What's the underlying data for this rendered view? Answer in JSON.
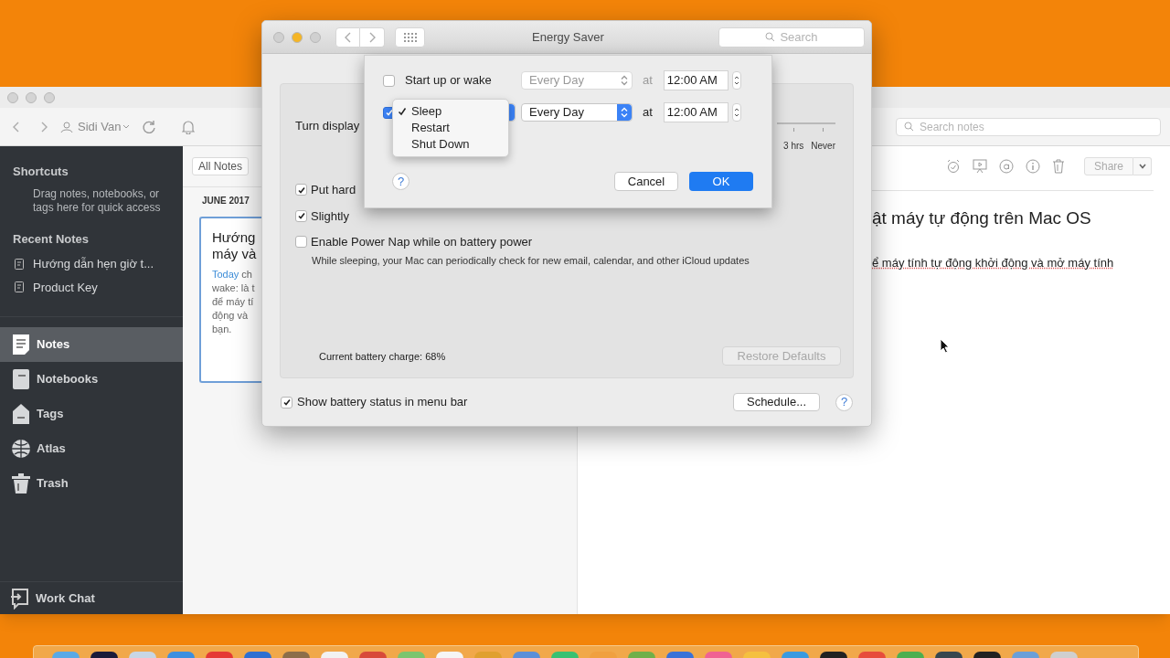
{
  "notes_app": {
    "toolbar": {
      "account": "Sidi Van",
      "search_placeholder": "Search notes"
    },
    "sidebar": {
      "shortcuts_heading": "Shortcuts",
      "shortcuts_hint": "Drag notes, notebooks, or tags here for quick access",
      "recent_heading": "Recent Notes",
      "recent": [
        "Hướng dẫn hẹn giờ t...",
        "Product Key"
      ],
      "items": [
        {
          "label": "Notes",
          "kind": "notes",
          "selected": true
        },
        {
          "label": "Notebooks",
          "kind": "notebooks",
          "selected": false
        },
        {
          "label": "Tags",
          "kind": "tags",
          "selected": false
        },
        {
          "label": "Atlas",
          "kind": "atlas",
          "selected": false
        },
        {
          "label": "Trash",
          "kind": "trash",
          "selected": false
        }
      ],
      "work_chat": "Work Chat"
    },
    "note_list": {
      "filter": "All Notes",
      "month": "JUNE 2017",
      "card": {
        "selected": true,
        "title_lines": [
          "Hướng",
          "máy và"
        ],
        "date": "Today",
        "snippet_lines": [
          "ch",
          "wake: là t",
          "để máy tí",
          "động và",
          "bạn."
        ]
      }
    },
    "editor": {
      "share": "Share",
      "title": "ật máy tự động trên Mac OS",
      "body": "ể máy tính tự động khởi động và mở máy tính"
    }
  },
  "energy_saver": {
    "title": "Energy Saver",
    "search_placeholder": "Search",
    "turn_display_label": "Turn display",
    "slider_ticks": [
      "3 hrs",
      "Never"
    ],
    "options": [
      {
        "label": "Put hard",
        "checked": true
      },
      {
        "label": "Slightly",
        "checked": true
      },
      {
        "label": "Enable Power Nap while on battery power",
        "checked": false,
        "description": "While sleeping, your Mac can periodically check for new email, calendar, and other iCloud updates"
      }
    ],
    "battery_charge": "Current battery charge: 68%",
    "restore_defaults": {
      "label": "Restore Defaults",
      "disabled": true
    },
    "show_battery": {
      "label": "Show battery status in menu bar",
      "checked": true
    },
    "schedule_button": "Schedule...",
    "help": "?",
    "schedule_sheet": {
      "rows": [
        {
          "checked": false,
          "label": "Start up or wake",
          "day": "Every Day",
          "disabled": true,
          "at": "at",
          "time": "12:00 AM"
        },
        {
          "checked": true,
          "day": "Every Day",
          "disabled": false,
          "at": "at",
          "time": "12:00 AM"
        }
      ],
      "menu": [
        {
          "label": "Sleep",
          "selected": true
        },
        {
          "label": "Restart",
          "selected": false
        },
        {
          "label": "Shut Down",
          "selected": false
        }
      ],
      "help": "?",
      "cancel": "Cancel",
      "ok": "OK"
    }
  }
}
